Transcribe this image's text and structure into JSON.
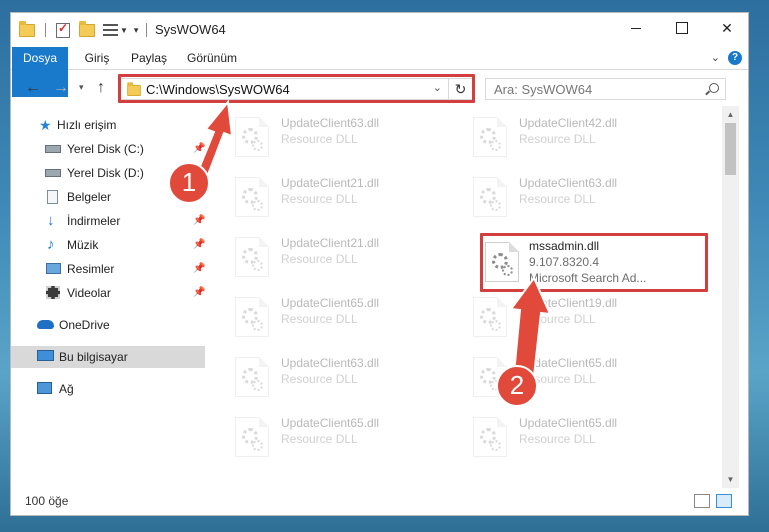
{
  "window": {
    "title": "SysWOW64",
    "ribbon_tabs": [
      "Dosya",
      "Giriş",
      "Paylaş",
      "Görünüm"
    ],
    "help": "?",
    "close": "✕"
  },
  "address": {
    "path": "C:\\Windows\\SysWOW64",
    "search_placeholder": "Ara: SysWOW64"
  },
  "sidebar": {
    "items": [
      {
        "label": "Hızlı erişim",
        "icon": "star-icon"
      },
      {
        "label": "Yerel Disk (C:)",
        "icon": "drive-icon",
        "pinned": true
      },
      {
        "label": "Yerel Disk (D:)",
        "icon": "drive-icon",
        "pinned": true
      },
      {
        "label": "Belgeler",
        "icon": "documents-icon",
        "pinned": true
      },
      {
        "label": "İndirmeler",
        "icon": "download-icon",
        "pinned": true
      },
      {
        "label": "Müzik",
        "icon": "music-icon",
        "pinned": true
      },
      {
        "label": "Resimler",
        "icon": "pictures-icon",
        "pinned": true
      },
      {
        "label": "Videolar",
        "icon": "video-icon",
        "pinned": true
      },
      {
        "label": "OneDrive",
        "icon": "cloud-icon"
      },
      {
        "label": "Bu bilgisayar",
        "icon": "computer-icon",
        "selected": true
      },
      {
        "label": "Ağ",
        "icon": "network-icon"
      }
    ]
  },
  "files": [
    {
      "name": "UpdateClient63.dll",
      "type": "Resource DLL"
    },
    {
      "name": "UpdateClient42.dll",
      "type": "Resource DLL"
    },
    {
      "name": "UpdateClient21.dll",
      "type": "Resource DLL"
    },
    {
      "name": "UpdateClient63.dll",
      "type": "Resource DLL"
    },
    {
      "name": "UpdateClient21.dll",
      "type": "Resource DLL"
    },
    {
      "name": "mssadmin.dll",
      "version": "9.107.8320.4",
      "description": "Microsoft Search Ad..."
    },
    {
      "name": "UpdateClient65.dll",
      "type": "Resource DLL"
    },
    {
      "name": "UpdateClient19.dll",
      "type": "Resource DLL"
    },
    {
      "name": "UpdateClient63.dll",
      "type": "Resource DLL"
    },
    {
      "name": "UpdateClient65.dll",
      "type": "Resource DLL"
    },
    {
      "name": "UpdateClient65.dll",
      "type": "Resource DLL"
    },
    {
      "name": "UpdateClient65.dll",
      "type": "Resource DLL"
    }
  ],
  "status": {
    "count": "100 öğe"
  },
  "callouts": [
    "1",
    "2"
  ],
  "colors": {
    "accent": "#1979ca",
    "highlight": "#d33e3e",
    "callout": "#e14a3a"
  }
}
